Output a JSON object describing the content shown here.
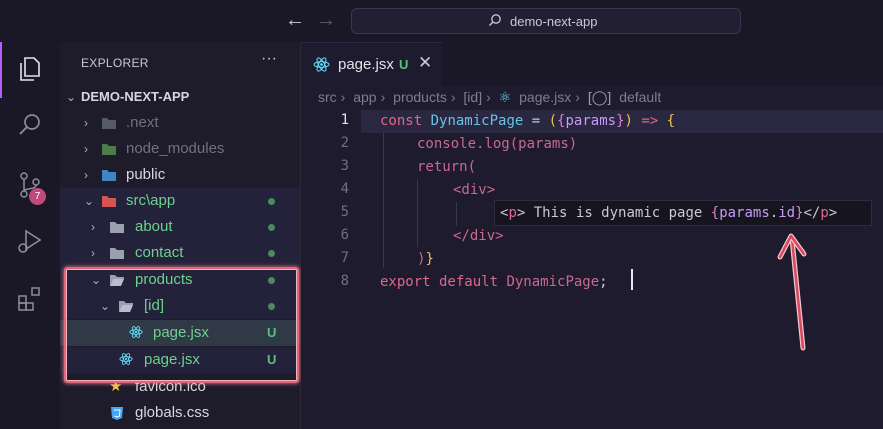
{
  "titlebar": {
    "search_text": "demo-next-app"
  },
  "activity": {
    "scm_badge": "7"
  },
  "sidebar": {
    "title": "EXPLORER",
    "more": "···",
    "root": "DEMO-NEXT-APP",
    "items": [
      {
        "label": ".next"
      },
      {
        "label": "node_modules"
      },
      {
        "label": "public"
      },
      {
        "label": "src\\app"
      },
      {
        "label": "about"
      },
      {
        "label": "contact"
      },
      {
        "label": "products"
      },
      {
        "label": "[id]"
      },
      {
        "label": "page.jsx",
        "status": "U"
      },
      {
        "label": "page.jsx",
        "status": "U"
      },
      {
        "label": "favicon.ico"
      },
      {
        "label": "globals.css"
      }
    ]
  },
  "editor": {
    "tab": {
      "label": "page.jsx",
      "status": "U"
    },
    "breadcrumbs": [
      "src",
      "app",
      "products",
      "[id]",
      "page.jsx",
      "default"
    ],
    "line_numbers": [
      "1",
      "2",
      "3",
      "4",
      "5",
      "6",
      "7",
      "8"
    ],
    "code": {
      "l1_const": "const",
      "l1_name": "DynamicPage",
      "l1_eq": " = ",
      "l1_paren_open": "(",
      "l1_brace_open": "{",
      "l1_params": "params",
      "l1_brace_close": "}",
      "l1_paren_close": ")",
      "l1_arrow": " => ",
      "l1_body_open": "{",
      "l2_console": "console",
      "l2_dot": ".",
      "l2_log": "log",
      "l2_args": "(params)",
      "l3_return": "return",
      "l3_paren": "(",
      "l4_div_open": "<div>",
      "l5_p_open_lt": "<",
      "l5_p_tag": "p",
      "l5_p_open_gt": ">",
      "l5_text": " This is dynamic page ",
      "l5_expr_open": "{",
      "l5_expr_params": "params",
      "l5_expr_dot": ".",
      "l5_expr_id": "id",
      "l5_expr_close": "}",
      "l5_p_close_lt": "</",
      "l5_p_close_tag": "p",
      "l5_p_close_gt": ">",
      "l6_div_close": "</div>",
      "l7_paren": ")",
      "l7_brace": "}",
      "l8_export": "export default",
      "l8_name": " DynamicPage",
      "l8_semi": ";"
    }
  },
  "colors": {
    "accent": "#b55cff",
    "highlight_box": "#e0667a",
    "untracked": "#57c27a"
  }
}
